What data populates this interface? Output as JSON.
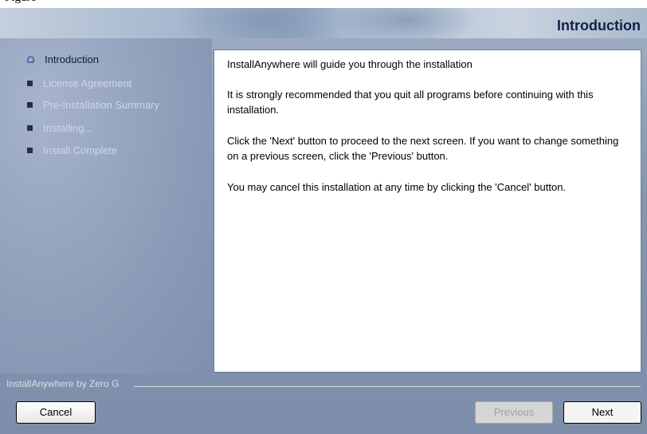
{
  "header": {
    "title": "Introduction"
  },
  "sidebar": {
    "steps": [
      {
        "label": "Introduction",
        "state": "current"
      },
      {
        "label": "License Agreement",
        "state": "pending"
      },
      {
        "label": "Pre-Installation Summary",
        "state": "pending"
      },
      {
        "label": "Installing...",
        "state": "pending"
      },
      {
        "label": "Install Complete",
        "state": "pending"
      }
    ]
  },
  "content": {
    "paragraphs": [
      "InstallAnywhere will guide you through the installation",
      "It is strongly recommended that you quit all programs before continuing with this installation.",
      "Click the 'Next' button to proceed to the next screen. If you want to change something on a previous screen, click the 'Previous' button.",
      "You may cancel this installation at any time by clicking the 'Cancel' button."
    ]
  },
  "footer": {
    "brand": "InstallAnywhere by Zero G",
    "cancel_label": "Cancel",
    "previous_label": "Previous",
    "next_label": "Next"
  },
  "colors": {
    "banner_title": "#0f2347",
    "sidebar_bg": "#8e9eb9",
    "content_bg": "#ffffff"
  }
}
